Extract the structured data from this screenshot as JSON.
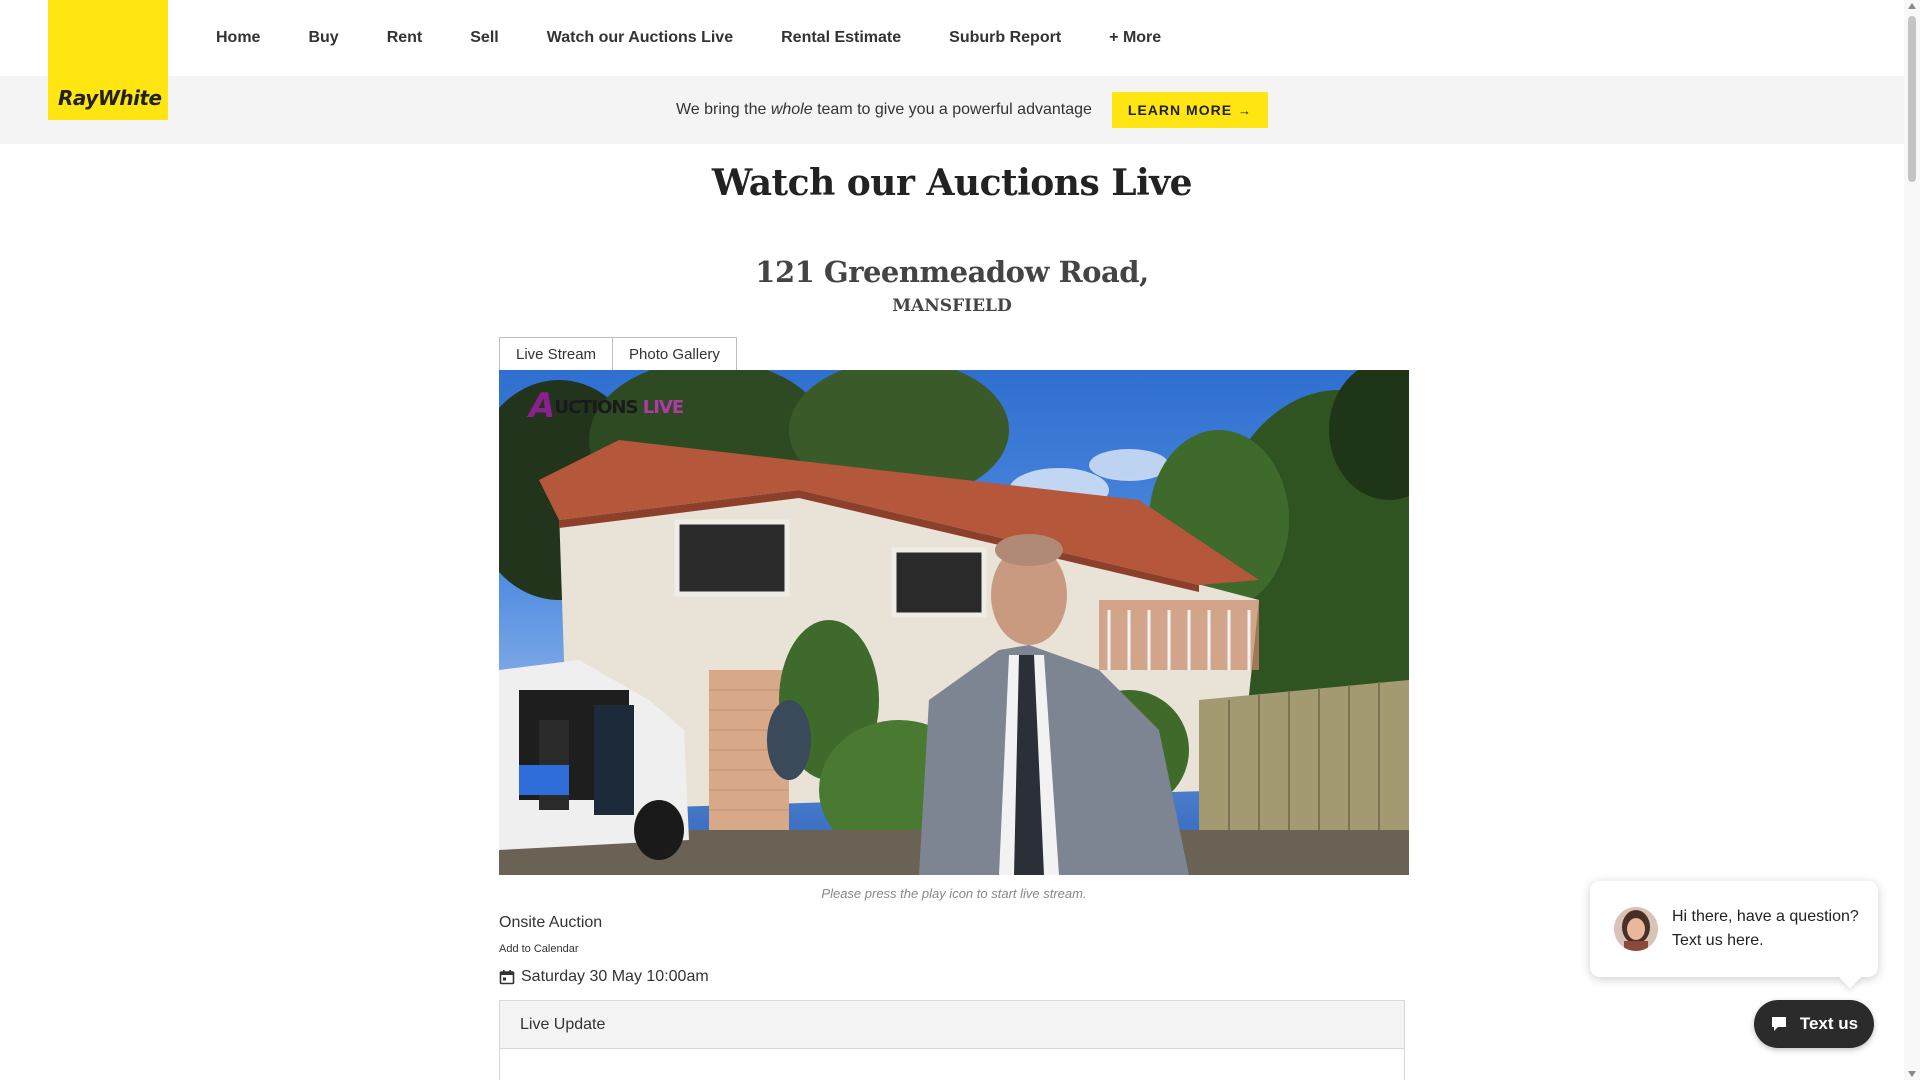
{
  "brand": {
    "name": "RayWhite",
    "accent": "#ffe512"
  },
  "nav": {
    "items": [
      {
        "label": "Home"
      },
      {
        "label": "Buy"
      },
      {
        "label": "Rent"
      },
      {
        "label": "Sell"
      },
      {
        "label": "Watch our Auctions Live"
      },
      {
        "label": "Rental Estimate"
      },
      {
        "label": "Suburb Report"
      },
      {
        "label": "+ More"
      }
    ]
  },
  "banner": {
    "text_before": "We bring the ",
    "text_emphasis": "whole",
    "text_after": " team to give you a powerful advantage",
    "button_label": "LEARN MORE",
    "button_icon": "arrow-right-icon"
  },
  "page": {
    "title": "Watch our Auctions Live",
    "address": "121 Greenmeadow Road,",
    "suburb": "MANSFIELD"
  },
  "tabs": [
    {
      "label": "Live Stream"
    },
    {
      "label": "Photo Gallery"
    }
  ],
  "video": {
    "watermark_first": "A",
    "watermark_mid": "UCTIONS ",
    "watermark_last": "LIVE",
    "caption": "Please press the play icon to start live stream."
  },
  "auction": {
    "type": "Onsite Auction",
    "add_to_calendar": "Add to Calendar",
    "date": "Saturday 30 May 10:00am",
    "calendar_icon": "calendar-icon"
  },
  "live_update": {
    "heading": "Live Update"
  },
  "chat": {
    "message": "Hi there, have a question? Text us here.",
    "button_label": "Text us",
    "button_icon": "chat-icon"
  }
}
